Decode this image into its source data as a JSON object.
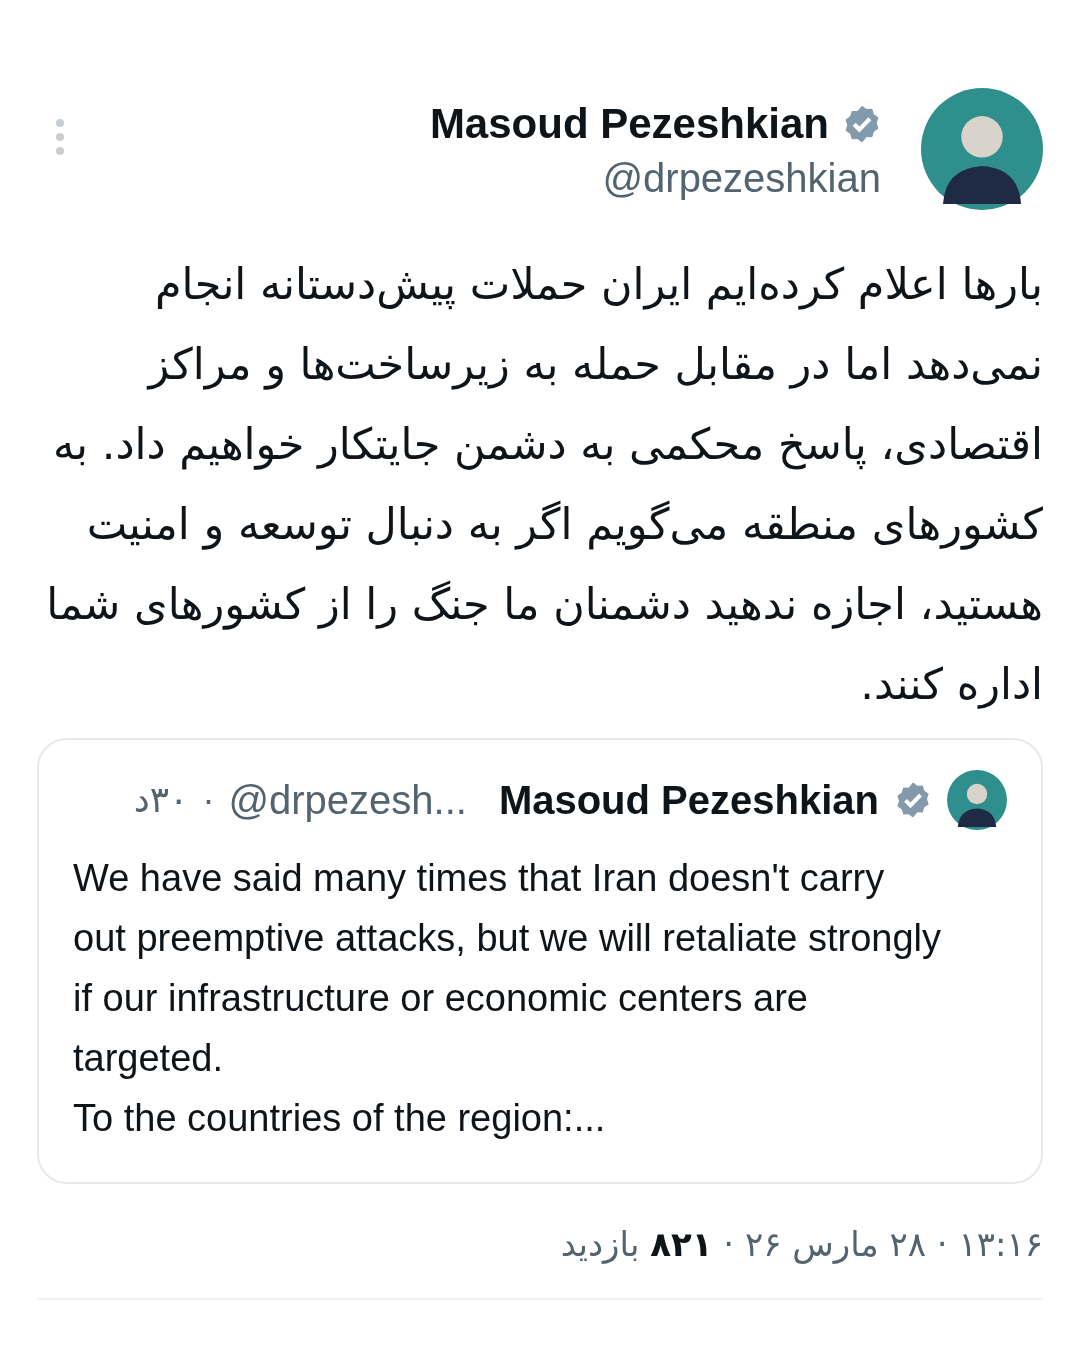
{
  "author": {
    "name": "Masoud Pezeshkian",
    "verified": true,
    "handle": "@drpezeshkian"
  },
  "tweet_text": "بارها اعلام کرده‌ایم ایران حملات پیش‌دستانه انجام نمی‌دهد اما در مقابل حمله به زیرساخت‌ها و مراکز اقتصادی، پاسخ محکمی به دشمن جایتکار خواهیم داد. به کشورهای منطقه می‌گویم اگر به دنبال توسعه و امنیت هستید، اجازه ندهید دشمنان ما جنگ را از کشورهای شما اداره کنند.",
  "quoted_tweet": {
    "name": "Masoud Pezeshkian",
    "verified": true,
    "handle": "@drpezesh...",
    "separator": "·",
    "time": "۳۰د",
    "paragraphs": [
      "We have said many times that Iran doesn't carry out preemptive attacks, but we will retaliate strongly if our infrastructure or economic centers are targeted.",
      "To the countries of the region:..."
    ]
  },
  "footer": "۱۳:۱۶ · ۲۸ مارس ۲۶ · **۸۲۱** بازدید"
}
